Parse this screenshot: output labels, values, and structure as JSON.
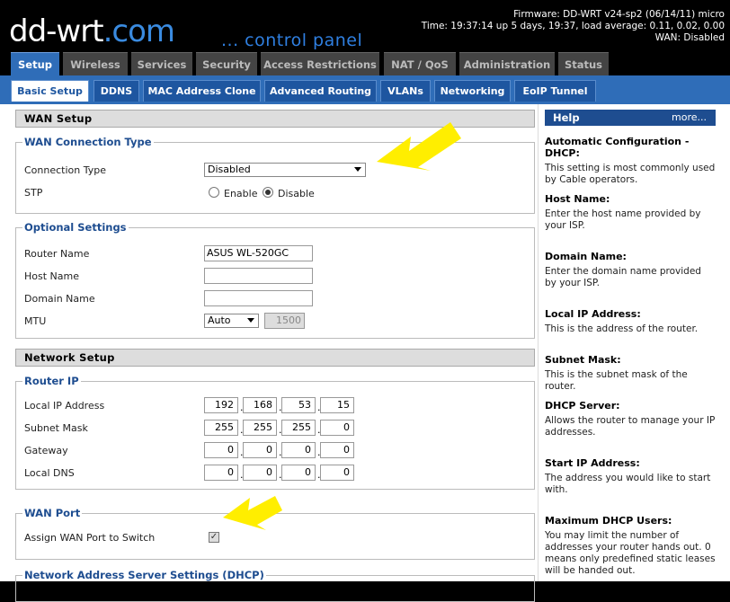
{
  "header": {
    "logo": "dd-wrt",
    "logo_dot": ".",
    "logo_com": "com",
    "tagline": "... control panel",
    "firmware": "Firmware: DD-WRT v24-sp2 (06/14/11) micro",
    "time": "Time: 19:37:14 up 5 days, 19:37, load average: 0.11, 0.02, 0.00",
    "wan": "WAN: Disabled"
  },
  "main_tabs": [
    {
      "label": "Setup",
      "active": true
    },
    {
      "label": "Wireless"
    },
    {
      "label": "Services"
    },
    {
      "label": "Security"
    },
    {
      "label": "Access Restrictions"
    },
    {
      "label": "NAT / QoS"
    },
    {
      "label": "Administration"
    },
    {
      "label": "Status"
    }
  ],
  "sub_tabs": [
    {
      "label": "Basic Setup",
      "active": true
    },
    {
      "label": "DDNS"
    },
    {
      "label": "MAC Address Clone"
    },
    {
      "label": "Advanced Routing"
    },
    {
      "label": "VLANs"
    },
    {
      "label": "Networking"
    },
    {
      "label": "EoIP Tunnel"
    }
  ],
  "wan_setup": {
    "title": "WAN Setup",
    "connection_type_legend": "WAN Connection Type",
    "connection_type_label": "Connection Type",
    "connection_type_value": "Disabled",
    "stp_label": "STP",
    "stp_enable": "Enable",
    "stp_disable": "Disable",
    "optional_legend": "Optional Settings",
    "router_name_label": "Router Name",
    "router_name_value": "ASUS WL-520GC",
    "host_name_label": "Host Name",
    "host_name_value": "",
    "domain_name_label": "Domain Name",
    "domain_name_value": "",
    "mtu_label": "MTU",
    "mtu_mode": "Auto",
    "mtu_value": "1500"
  },
  "network_setup": {
    "title": "Network Setup",
    "router_ip_legend": "Router IP",
    "local_ip_label": "Local IP Address",
    "local_ip": [
      "192",
      "168",
      "53",
      "15"
    ],
    "subnet_label": "Subnet Mask",
    "subnet": [
      "255",
      "255",
      "255",
      "0"
    ],
    "gateway_label": "Gateway",
    "gateway": [
      "0",
      "0",
      "0",
      "0"
    ],
    "dns_label": "Local DNS",
    "dns": [
      "0",
      "0",
      "0",
      "0"
    ],
    "wan_port_legend": "WAN Port",
    "assign_wan_label": "Assign WAN Port to Switch",
    "assign_wan_check": "✓",
    "dhcp_legend": "Network Address Server Settings (DHCP)"
  },
  "help": {
    "title": "Help",
    "more": "more...",
    "items": [
      {
        "title": "Automatic Configuration - DHCP:",
        "desc": "This setting is most commonly used by Cable operators."
      },
      {
        "title": "Host Name:",
        "desc": "Enter the host name provided by your ISP."
      },
      {
        "title": "Domain Name:",
        "desc": "Enter the domain name provided by your ISP."
      },
      {
        "title": "Local IP Address:",
        "desc": "This is the address of the router."
      },
      {
        "title": "Subnet Mask:",
        "desc": "This is the subnet mask of the router."
      },
      {
        "title": "DHCP Server:",
        "desc": "Allows the router to manage your IP addresses."
      },
      {
        "title": "Start IP Address:",
        "desc": "The address you would like to start with."
      },
      {
        "title": "Maximum DHCP Users:",
        "desc": "You may limit the number of addresses your router hands out. 0 means only predefined static leases will be handed out."
      }
    ]
  },
  "colors": {
    "accent": "#2f6db8",
    "arrow": "#ffee00"
  }
}
